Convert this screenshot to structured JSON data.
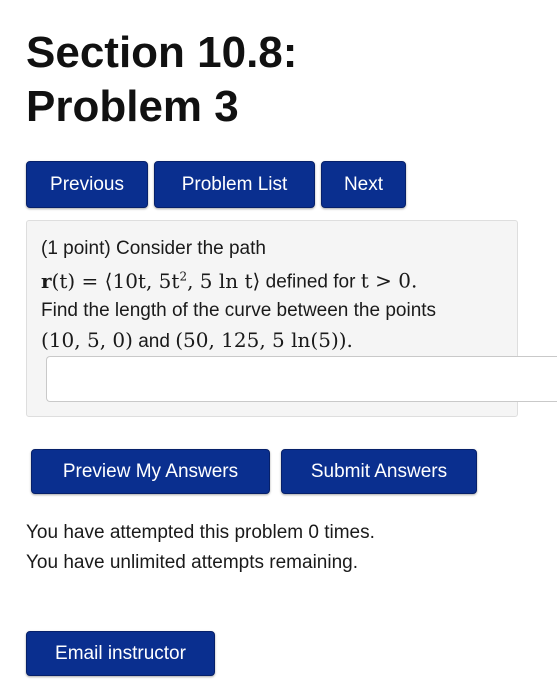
{
  "page": {
    "title_line1": "Section 10.8:",
    "title_line2": "Problem 3"
  },
  "nav": {
    "previous": "Previous",
    "problem_list": "Problem List",
    "next": "Next"
  },
  "problem": {
    "points": "(1 point) Consider the path",
    "vector_lhs": "r",
    "vector_arg": "(t) = ⟨10t, 5t",
    "vector_exp": "2",
    "vector_rest": ", 5 ln t⟩",
    "defined_for": " defined for ",
    "condition": "t > 0.",
    "question": "Find the length of the curve between the points",
    "point_a": "(10, 5, 0)",
    "and": " and ",
    "point_b": "(50, 125, 5 ln(5)).",
    "answer_value": ""
  },
  "actions": {
    "preview": "Preview My Answers",
    "submit": "Submit Answers"
  },
  "status": {
    "attempts": "You have attempted this problem 0 times.",
    "remaining": "You have unlimited attempts remaining."
  },
  "footer": {
    "email": "Email instructor"
  },
  "colors": {
    "button_bg": "#0a2f8f",
    "panel_bg": "#f5f5f5"
  }
}
